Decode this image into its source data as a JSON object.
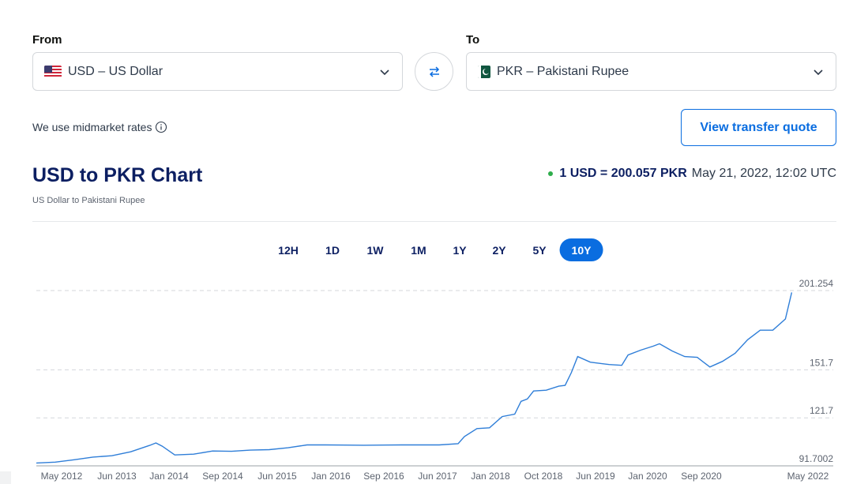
{
  "converter": {
    "from_label": "From",
    "to_label": "To",
    "from_value": "USD – US Dollar",
    "to_value": "PKR – Pakistani Rupee",
    "from_flag": "us-flag-icon",
    "to_flag": "pk-flag-icon"
  },
  "midmarket_text": "We use midmarket rates",
  "quote_button": "View transfer quote",
  "chart_title": "USD to PKR Chart",
  "chart_subtitle": "US Dollar to Pakistani Rupee",
  "rate": {
    "value_text": "1 USD = 200.057 PKR",
    "timestamp": "May 21, 2022, 12:02 UTC",
    "status_color": "#2ead4b"
  },
  "ranges": {
    "items": [
      "12H",
      "1D",
      "1W",
      "1M",
      "1Y",
      "2Y",
      "5Y",
      "10Y"
    ],
    "active": "10Y"
  },
  "colors": {
    "accent": "#0a6de0",
    "title": "#0c1f62",
    "line": "#2f7ed8"
  },
  "chart_data": {
    "type": "line",
    "title": "",
    "xlabel": "",
    "ylabel": "",
    "y_ticks": [
      "201.254",
      "151.7",
      "121.7",
      "91.7002"
    ],
    "ylim": [
      91.7002,
      201.254
    ],
    "x_ticks": [
      "May 2012",
      "Jun 2013",
      "Jan 2014",
      "Sep 2014",
      "Jun 2015",
      "Jan 2016",
      "Sep 2016",
      "Jun 2017",
      "Jan 2018",
      "Oct 2018",
      "Jun 2019",
      "Jan 2020",
      "Sep 2020",
      "May 2022"
    ],
    "grid": "horizontal dashed",
    "series": [
      {
        "x": [
          "2012-05",
          "2012-08",
          "2012-11",
          "2013-02",
          "2013-05",
          "2013-08",
          "2013-11",
          "2013-12",
          "2014-01",
          "2014-03",
          "2014-06",
          "2014-09",
          "2014-12",
          "2015-03",
          "2015-06",
          "2015-09",
          "2015-12",
          "2016-03",
          "2016-06",
          "2016-09",
          "2016-12",
          "2017-03",
          "2017-06",
          "2017-09",
          "2017-12",
          "2018-01",
          "2018-03",
          "2018-05",
          "2018-07",
          "2018-09",
          "2018-10",
          "2018-11",
          "2018-12",
          "2019-02",
          "2019-04",
          "2019-05",
          "2019-06",
          "2019-07",
          "2019-09",
          "2019-12",
          "2020-02",
          "2020-03",
          "2020-05",
          "2020-07",
          "2020-08",
          "2020-10",
          "2020-12",
          "2021-02",
          "2021-04",
          "2021-06",
          "2021-08",
          "2021-10",
          "2021-12",
          "2022-02",
          "2022-04",
          "2022-05"
        ],
        "y": [
          93.5,
          94.0,
          95.5,
          97.2,
          98.0,
          100.5,
          104.5,
          106.0,
          104.0,
          98.5,
          99.0,
          101.0,
          100.8,
          101.5,
          101.8,
          103.0,
          104.8,
          104.8,
          104.7,
          104.6,
          104.7,
          104.8,
          104.8,
          104.8,
          105.5,
          110.0,
          115.0,
          115.5,
          122.5,
          124.0,
          132.0,
          133.5,
          138.5,
          139.0,
          141.5,
          142.0,
          150.0,
          160.0,
          156.5,
          155.0,
          154.5,
          161.0,
          164.0,
          166.5,
          168.0,
          163.5,
          160.0,
          159.5,
          153.5,
          157.0,
          162.0,
          170.5,
          176.5,
          176.5,
          183.5,
          200.057
        ]
      }
    ]
  }
}
